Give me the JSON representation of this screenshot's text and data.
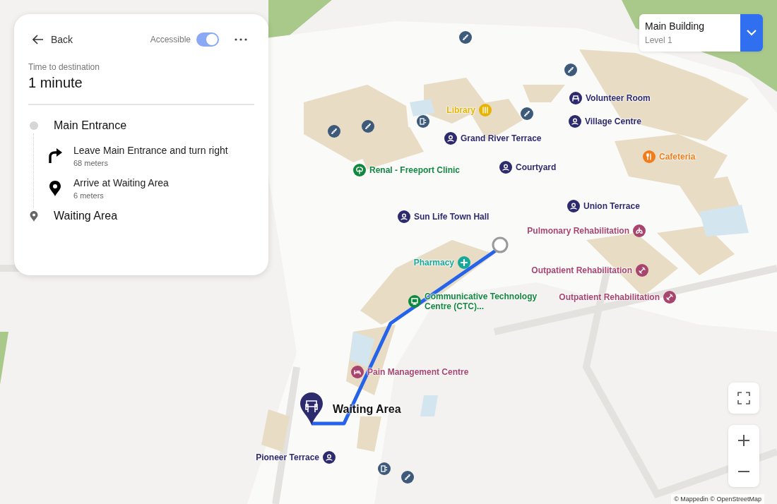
{
  "route_panel": {
    "back": "Back",
    "accessible": {
      "label": "Accessible",
      "on": true
    },
    "time_label": "Time to destination",
    "time": "1 minute",
    "start": "Main Entrance",
    "steps": [
      {
        "kind": "turn-right",
        "text": "Leave Main Entrance and turn right",
        "distance": "68 meters"
      },
      {
        "kind": "arrive",
        "text": "Arrive at Waiting Area",
        "distance": "6 meters"
      }
    ],
    "end": "Waiting Area"
  },
  "building_selector": {
    "building": "Main Building",
    "level": "Level 1"
  },
  "map": {
    "places": [
      {
        "name": "Library",
        "kind": "library",
        "color": "#e6b400"
      },
      {
        "name": "Volunteer Room",
        "kind": "chair",
        "color": "#2d2a6e"
      },
      {
        "name": "Village Centre",
        "kind": "venue",
        "color": "#2d2a6e"
      },
      {
        "name": "Grand River Terrace",
        "kind": "venue",
        "color": "#2d2a6e"
      },
      {
        "name": "Cafeteria",
        "kind": "food",
        "color": "#f07d1a"
      },
      {
        "name": "Renal - Freeport Clinic",
        "kind": "kidney",
        "color": "#12873f"
      },
      {
        "name": "Courtyard",
        "kind": "venue",
        "color": "#2d2a6e"
      },
      {
        "name": "Union Terrace",
        "kind": "venue",
        "color": "#2d2a6e"
      },
      {
        "name": "Sun Life Town Hall",
        "kind": "venue",
        "color": "#2d2a6e"
      },
      {
        "name": "Pulmonary Rehabilitation",
        "kind": "lungs",
        "color": "#a8456e"
      },
      {
        "name": "Pharmacy",
        "kind": "pharmacy",
        "color": "#16a89a"
      },
      {
        "name": "Communicative Technology Centre (CTC)...",
        "kind": "device",
        "color": "#12873f"
      },
      {
        "name": "Outpatient Rehabilitation",
        "kind": "rehab",
        "color": "#a8456e"
      },
      {
        "name": "Outpatient Rehabilitation",
        "kind": "rehab",
        "color": "#a8456e"
      },
      {
        "name": "Pain Management Centre",
        "kind": "bed",
        "color": "#a8456e"
      },
      {
        "name": "Pioneer Terrace",
        "kind": "venue",
        "color": "#2d2a6e"
      }
    ],
    "destination": "Waiting Area"
  },
  "attribution": "© Mappedin © OpenStreetMap"
}
